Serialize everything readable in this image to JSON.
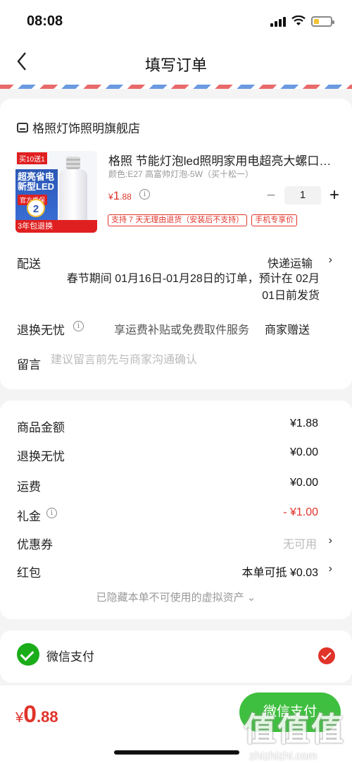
{
  "status": {
    "time": "08:08"
  },
  "nav": {
    "title": "填写订单",
    "back_icon": "chevron-left-icon"
  },
  "store": {
    "name": "格照灯饰照明旗舰店"
  },
  "product": {
    "image_text": {
      "top_tag": "买10送1",
      "headline": "超亮省电新型LED",
      "badge_tag": "官方质保",
      "badge_number": "2",
      "bottom_text": "3年包退换"
    },
    "name": "格照 节能灯泡led照明家用电超亮大螺口…",
    "variant": "颜色:E27 高富帅灯泡-5W（买十松一）",
    "price_symbol": "¥",
    "price_int": "1",
    "price_dec": ".88",
    "quantity": "1",
    "tags": [
      "支持 7 天无理由退货（安装后不支持）",
      "手机专享价"
    ]
  },
  "delivery": {
    "label": "配送",
    "method": "快递运输",
    "note": "春节期间 01月16日-01月28日的订单，预计在 02月01日前发货"
  },
  "return_service": {
    "label": "退换无忧",
    "desc": "享运费补贴或免费取件服务",
    "value": "商家赠送"
  },
  "message": {
    "label": "留言",
    "placeholder": "建议留言前先与商家沟通确认"
  },
  "summary": {
    "goods_label": "商品金额",
    "goods_value": "¥1.88",
    "return_label": "退换无忧",
    "return_value": "¥0.00",
    "shipping_label": "运费",
    "shipping_value": "¥0.00",
    "gift_label": "礼金",
    "gift_value": "- ¥1.00",
    "coupon_label": "优惠券",
    "coupon_value": "无可用",
    "redpacket_label": "红包",
    "redpacket_value": "本单可抵 ¥0.03",
    "hidden_note": "已隐藏本单不可使用的虚拟资产 ⌄"
  },
  "payment": {
    "method": "微信支付"
  },
  "footer": {
    "total_symbol": "¥",
    "total_int": "0",
    "total_dec": ".88",
    "submit_label": "微信支付",
    "watermark_chars": "值值值",
    "watermark_url": "zhizhizhi.com"
  },
  "colors": {
    "accent_red": "#e0332a",
    "wechat_green": "#1aad19",
    "submit_green": "#3fbf3f"
  }
}
